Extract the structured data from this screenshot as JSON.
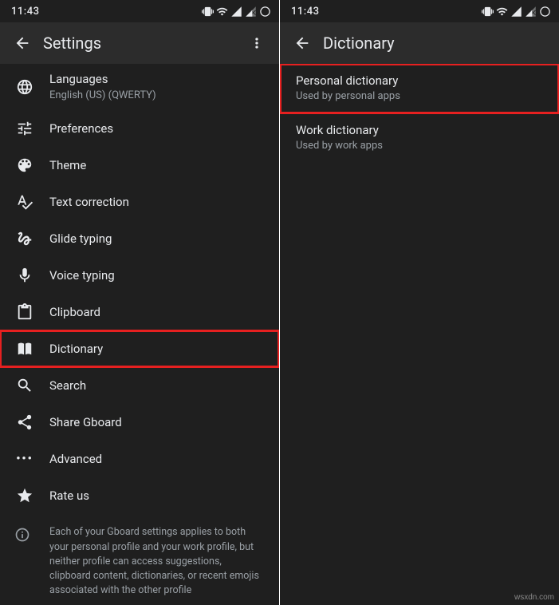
{
  "status": {
    "time": "11:43"
  },
  "left": {
    "title": "Settings",
    "items": [
      {
        "key": "languages",
        "label": "Languages",
        "sub": "English (US) (QWERTY)"
      },
      {
        "key": "preferences",
        "label": "Preferences"
      },
      {
        "key": "theme",
        "label": "Theme"
      },
      {
        "key": "textcorr",
        "label": "Text correction"
      },
      {
        "key": "glide",
        "label": "Glide typing"
      },
      {
        "key": "voice",
        "label": "Voice typing"
      },
      {
        "key": "clipboard",
        "label": "Clipboard"
      },
      {
        "key": "dictionary",
        "label": "Dictionary"
      },
      {
        "key": "search",
        "label": "Search"
      },
      {
        "key": "share",
        "label": "Share Gboard"
      },
      {
        "key": "advanced",
        "label": "Advanced"
      },
      {
        "key": "rate",
        "label": "Rate us"
      }
    ],
    "info": "Each of your Gboard settings applies to both your personal profile and your work profile, but neither profile can access suggestions, clipboard content, dictionaries, or recent emojis associated with the other profile"
  },
  "right": {
    "title": "Dictionary",
    "items": [
      {
        "key": "personal",
        "label": "Personal dictionary",
        "sub": "Used by personal apps"
      },
      {
        "key": "work",
        "label": "Work dictionary",
        "sub": "Used by work apps"
      }
    ]
  },
  "watermark": "wsxdn.com"
}
